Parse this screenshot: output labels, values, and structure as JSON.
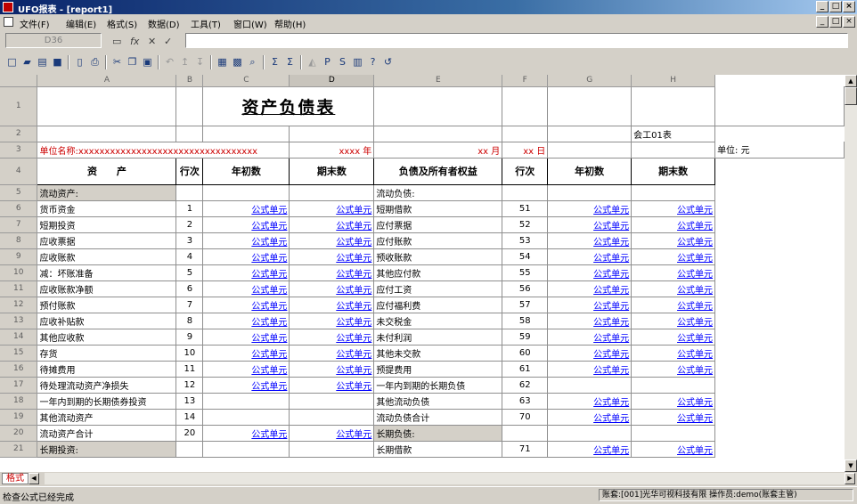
{
  "window": {
    "title": "UFO报表 - [report1]",
    "minimize": "_",
    "maximize": "□",
    "close": "×"
  },
  "menu": [
    "文件(F)",
    "编辑(E)",
    "格式(S)",
    "数据(D)",
    "工具(T)",
    "窗口(W)",
    "帮助(H)"
  ],
  "formula_bar": {
    "cell_ref": "D36",
    "formula": ""
  },
  "columns": [
    "A",
    "B",
    "C",
    "D",
    "E",
    "F",
    "G",
    "H"
  ],
  "selected_column": "D",
  "report": {
    "title": "资产负债表",
    "report_no": "会工01表",
    "unit_line": {
      "unit_label": "单位名称:",
      "unit_value": "xxxxxxxxxxxxxxxxxxxxxxxxxxxxxxxxxx",
      "year": "xxxx 年",
      "month": "xx 月",
      "day": "xx 日"
    },
    "currency": "单位: 元",
    "headers": [
      "资　　产",
      "行次",
      "年初数",
      "期末数",
      "负债及所有者权益",
      "行次",
      "年初数",
      "期末数"
    ],
    "formula_text": "公式单元",
    "rows": [
      {
        "n": "5",
        "a": "流动资产:",
        "b": "",
        "c": false,
        "d": false,
        "e": "流动负债:",
        "f": "",
        "g": false,
        "h": false,
        "ga": true,
        "ge": false
      },
      {
        "n": "6",
        "a": "货币资金",
        "b": "1",
        "c": true,
        "d": true,
        "e": "短期借款",
        "f": "51",
        "g": true,
        "h": true
      },
      {
        "n": "7",
        "a": "短期投资",
        "b": "2",
        "c": true,
        "d": true,
        "e": "应付票据",
        "f": "52",
        "g": true,
        "h": true
      },
      {
        "n": "8",
        "a": "应收票据",
        "b": "3",
        "c": true,
        "d": true,
        "e": "应付账款",
        "f": "53",
        "g": true,
        "h": true
      },
      {
        "n": "9",
        "a": "应收账款",
        "b": "4",
        "c": true,
        "d": true,
        "e": "预收账款",
        "f": "54",
        "g": true,
        "h": true
      },
      {
        "n": "10",
        "a": "减：坏账准备",
        "b": "5",
        "c": true,
        "d": true,
        "e": "其他应付款",
        "f": "55",
        "g": true,
        "h": true,
        "ia": 2
      },
      {
        "n": "11",
        "a": "应收账款净额",
        "b": "6",
        "c": true,
        "d": true,
        "e": "应付工资",
        "f": "56",
        "g": true,
        "h": true
      },
      {
        "n": "12",
        "a": "预付账款",
        "b": "7",
        "c": true,
        "d": true,
        "e": "应付福利费",
        "f": "57",
        "g": true,
        "h": true
      },
      {
        "n": "13",
        "a": "应收补贴款",
        "b": "8",
        "c": true,
        "d": true,
        "e": "未交税金",
        "f": "58",
        "g": true,
        "h": true
      },
      {
        "n": "14",
        "a": "其他应收款",
        "b": "9",
        "c": true,
        "d": true,
        "e": "未付利润",
        "f": "59",
        "g": true,
        "h": true
      },
      {
        "n": "15",
        "a": "存货",
        "b": "10",
        "c": true,
        "d": true,
        "e": "其他未交款",
        "f": "60",
        "g": true,
        "h": true
      },
      {
        "n": "16",
        "a": "待摊费用",
        "b": "11",
        "c": true,
        "d": true,
        "e": "预提费用",
        "f": "61",
        "g": true,
        "h": true
      },
      {
        "n": "17",
        "a": "待处理流动资产净损失",
        "b": "12",
        "c": true,
        "d": true,
        "e": "一年内到期的长期负债",
        "f": "62",
        "g": false,
        "h": false
      },
      {
        "n": "18",
        "a": "一年内到期的长期债券投资",
        "b": "13",
        "c": false,
        "d": false,
        "e": "其他流动负债",
        "f": "63",
        "g": true,
        "h": true
      },
      {
        "n": "19",
        "a": "其他流动资产",
        "b": "14",
        "c": false,
        "d": false,
        "e": "流动负债合计",
        "f": "70",
        "g": true,
        "h": true,
        "ie": 3
      },
      {
        "n": "20",
        "a": "流动资产合计",
        "b": "20",
        "c": true,
        "d": true,
        "e": "长期负债:",
        "f": "",
        "g": false,
        "h": false,
        "ia": 3,
        "ge": true
      },
      {
        "n": "21",
        "a": "长期投资:",
        "b": "",
        "c": false,
        "d": false,
        "e": "长期借款",
        "f": "71",
        "g": true,
        "h": true,
        "ga": true
      }
    ]
  },
  "sheet_tab": "格式",
  "status": {
    "left": "检查公式已经完成",
    "right": "账套:[001]光华可视科技有限 操作员:demo(账套主管)"
  }
}
